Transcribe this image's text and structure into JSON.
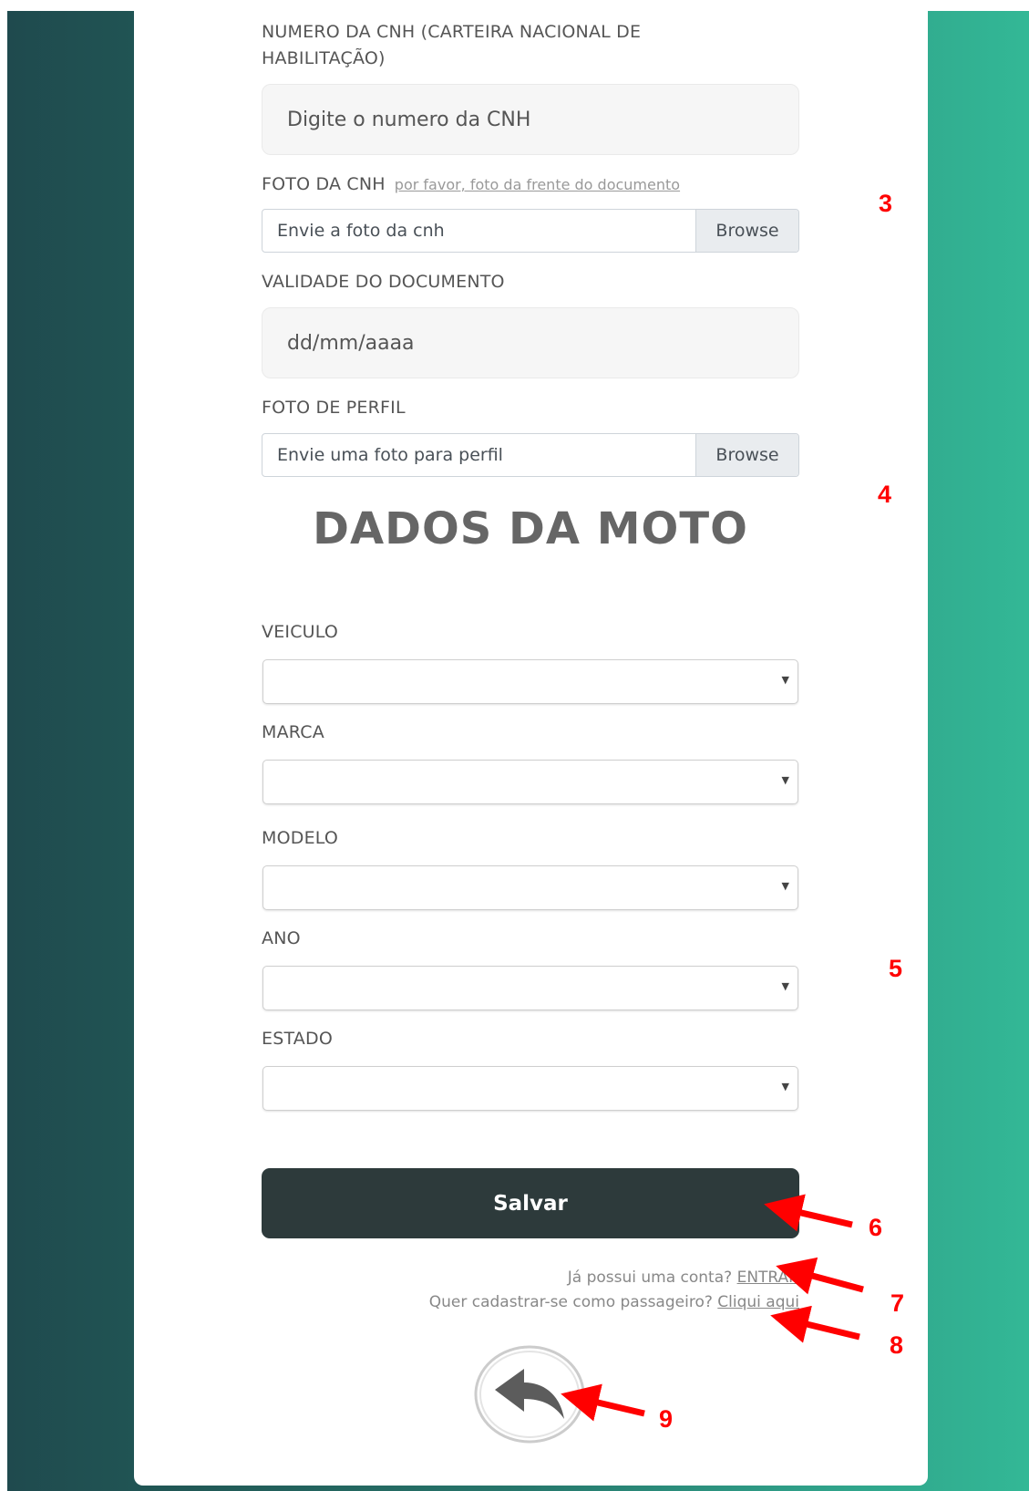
{
  "form": {
    "cnh_number": {
      "label": "NUMERO DA CNH (CARTEIRA NACIONAL DE HABILITAÇÃO)",
      "placeholder": "Digite o numero da CNH"
    },
    "cnh_photo": {
      "label": "FOTO DA CNH",
      "hint": "por favor, foto da frente do documento",
      "placeholder": "Envie a foto da cnh",
      "button": "Browse"
    },
    "validity": {
      "label": "VALIDADE DO DOCUMENTO",
      "placeholder": "dd/mm/aaaa"
    },
    "profile_photo": {
      "label": "FOTO DE PERFIL",
      "placeholder": "Envie uma foto para perfil",
      "button": "Browse"
    }
  },
  "moto_section": {
    "heading": "DADOS DA MOTO",
    "fields": [
      {
        "label": "VEICULO",
        "value": ""
      },
      {
        "label": "MARCA",
        "value": ""
      },
      {
        "label": "MODELO",
        "value": ""
      },
      {
        "label": "ANO",
        "value": ""
      },
      {
        "label": "ESTADO",
        "value": ""
      }
    ]
  },
  "save_button": "Salvar",
  "footer": {
    "login_prompt": "Já possui uma conta?",
    "login_link": "ENTRAR",
    "passenger_prompt": "Quer cadastrar-se como passageiro?",
    "passenger_link": "Cliqui aqui"
  },
  "back_button": {
    "icon": "reply-arrow-icon"
  },
  "annotations": [
    "3",
    "4",
    "5",
    "6",
    "7",
    "8",
    "9"
  ],
  "colors": {
    "save_button": "#2d3a3b",
    "annotation": "#ff0000",
    "background_left": "#1f4a4e",
    "background_right": "#33b896"
  }
}
